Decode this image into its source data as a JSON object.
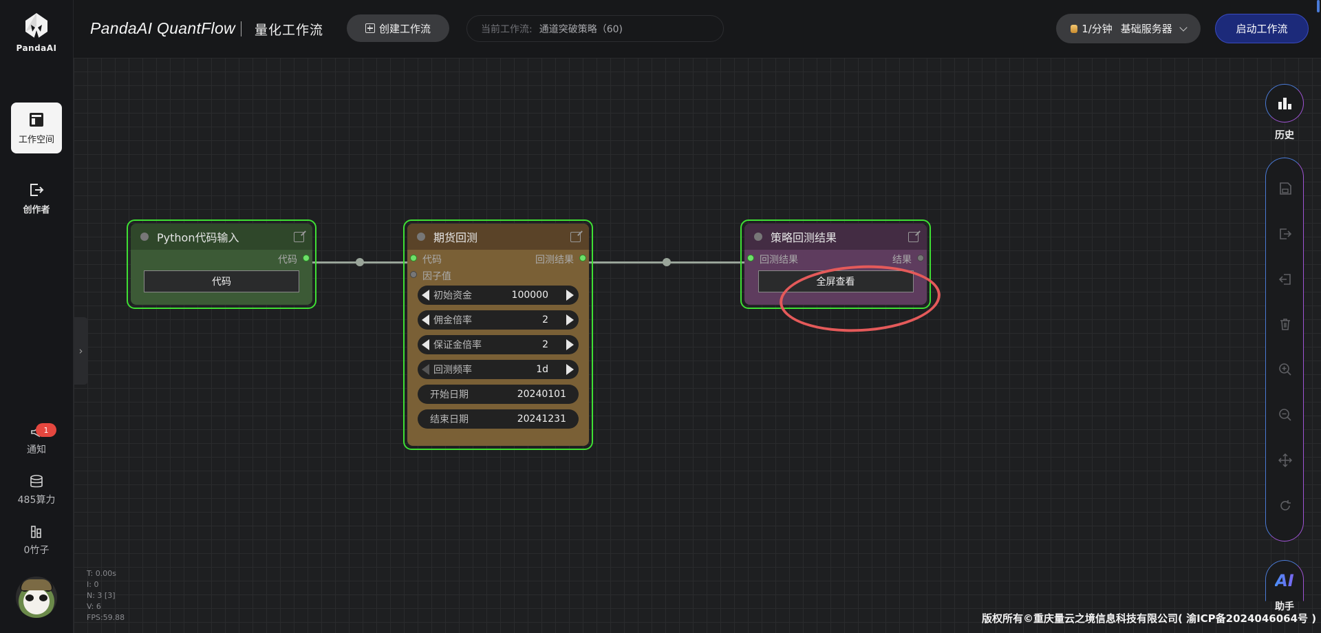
{
  "header": {
    "app_title": "PandaAI QuantFlow",
    "subtitle": "量化工作流",
    "create_button": "创建工作流",
    "current_flow_label": "当前工作流:",
    "current_flow_value": "通道突破策略（60)",
    "server_rate": "1/分钟",
    "server_name": "基础服务器",
    "start_button": "启动工作流"
  },
  "sidebar": {
    "logo_text": "PandaAI",
    "items": [
      {
        "label": "工作空间",
        "icon": "layout-icon",
        "active": true
      },
      {
        "label": "创作者",
        "icon": "exit-icon",
        "active": false
      }
    ],
    "notify_label": "通知",
    "notify_count": "1",
    "compute_label": "485算力",
    "bamboo_label": "0竹子"
  },
  "nodes": {
    "python": {
      "title": "Python代码输入",
      "output_label": "代码",
      "button": "代码"
    },
    "backtest": {
      "title": "期货回测",
      "input_code": "代码",
      "input_factor": "因子值",
      "output_label": "回测结果",
      "widgets": [
        {
          "label": "初始资金",
          "value": "100000"
        },
        {
          "label": "佣金倍率",
          "value": "2"
        },
        {
          "label": "保证金倍率",
          "value": "2"
        },
        {
          "label": "回测频率",
          "value": "1d"
        },
        {
          "label": "开始日期",
          "value": "20240101"
        },
        {
          "label": "结束日期",
          "value": "20241231"
        }
      ]
    },
    "result": {
      "title": "策略回测结果",
      "input_label": "回测结果",
      "output_label": "结果",
      "button": "全屏查看"
    }
  },
  "debug": {
    "t": "T: 0.00s",
    "i": "I: 0",
    "n": "N: 3 [3]",
    "v": "V: 6",
    "fps": "FPS:59.88"
  },
  "right_panel": {
    "history_label": "历史",
    "assistant_label": "助手",
    "assistant_icon_text": "AI",
    "tools": [
      "save-icon",
      "export-icon",
      "import-icon",
      "delete-icon",
      "zoom-in-icon",
      "zoom-out-icon",
      "fit-icon",
      "reset-icon"
    ]
  },
  "footer": {
    "copyright": "版权所有©重庆量云之境信息科技有限公司( 渝ICP备2024046064号 )"
  },
  "colors": {
    "node_border": "#3fe034",
    "python_node": "#3c5a36",
    "backtest_node": "#7a6036",
    "result_node": "#5e3c5e",
    "annotation": "#e45a5a",
    "start_button": "#1c2a7a"
  }
}
